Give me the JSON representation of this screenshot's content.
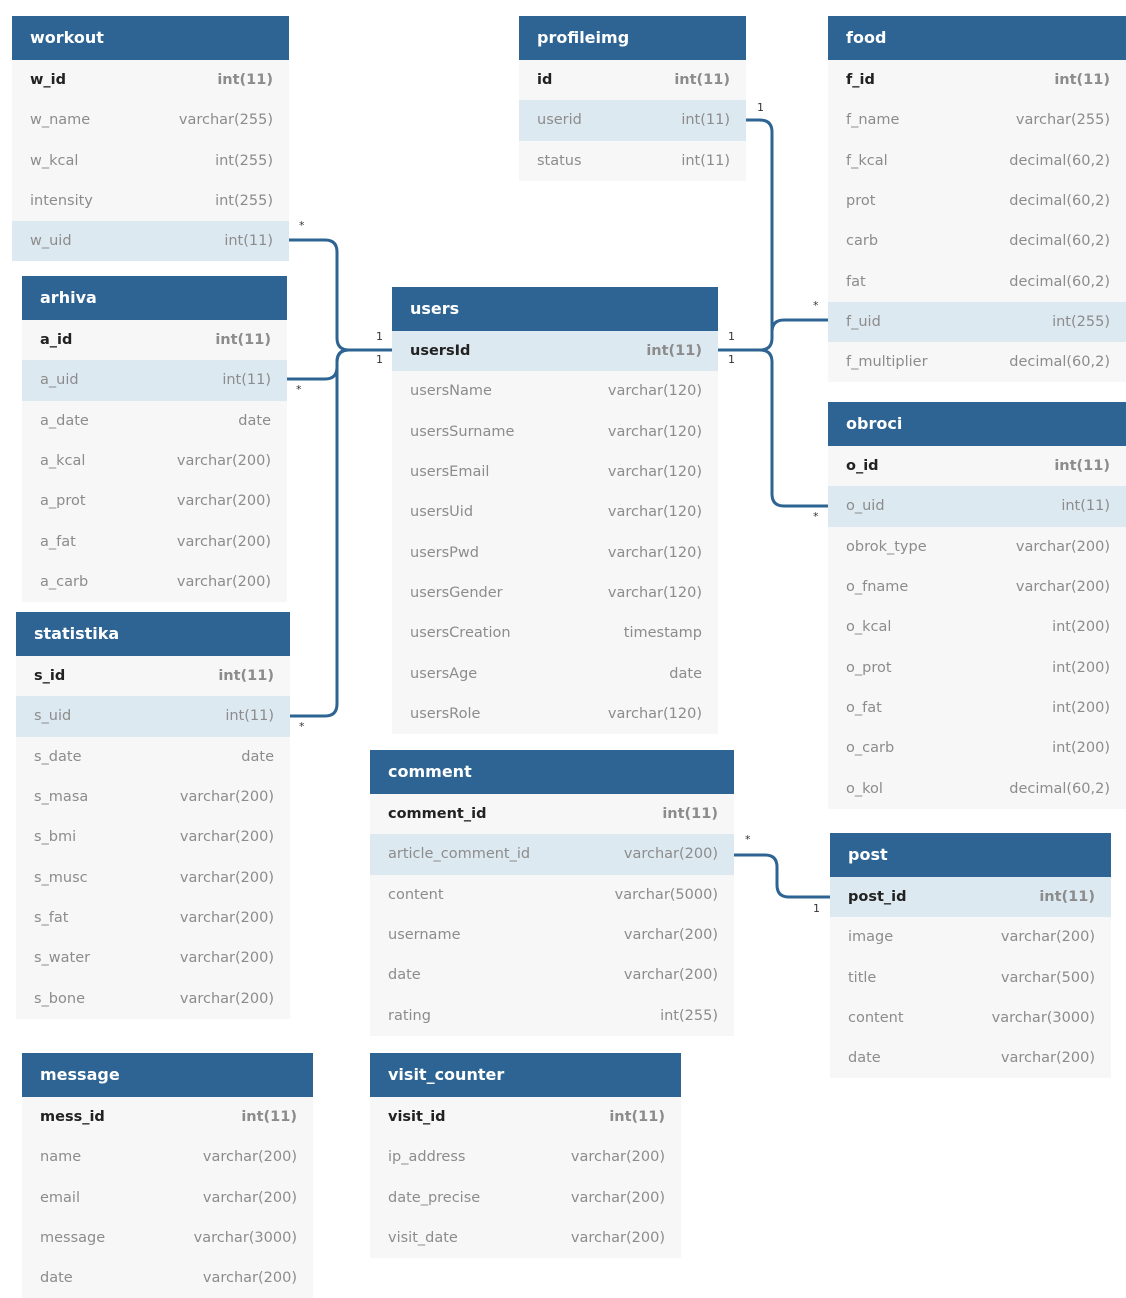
{
  "colors": {
    "header": "#2d6493",
    "connector": "#2d6493",
    "highlight": "#dde9f1",
    "body": "#f7f7f7"
  },
  "tables": [
    {
      "id": "workout",
      "name": "workout",
      "fields": [
        {
          "name": "w_id",
          "type": "int(11)",
          "pk": true
        },
        {
          "name": "w_name",
          "type": "varchar(255)"
        },
        {
          "name": "w_kcal",
          "type": "int(255)"
        },
        {
          "name": "intensity",
          "type": "int(255)"
        },
        {
          "name": "w_uid",
          "type": "int(11)",
          "hl": true
        }
      ]
    },
    {
      "id": "arhiva",
      "name": "arhiva",
      "fields": [
        {
          "name": "a_id",
          "type": "int(11)",
          "pk": true
        },
        {
          "name": "a_uid",
          "type": "int(11)",
          "hl": true
        },
        {
          "name": "a_date",
          "type": "date"
        },
        {
          "name": "a_kcal",
          "type": "varchar(200)"
        },
        {
          "name": "a_prot",
          "type": "varchar(200)"
        },
        {
          "name": "a_fat",
          "type": "varchar(200)"
        },
        {
          "name": "a_carb",
          "type": "varchar(200)"
        }
      ]
    },
    {
      "id": "statistika",
      "name": "statistika",
      "fields": [
        {
          "name": "s_id",
          "type": "int(11)",
          "pk": true
        },
        {
          "name": "s_uid",
          "type": "int(11)",
          "hl": true
        },
        {
          "name": "s_date",
          "type": "date"
        },
        {
          "name": "s_masa",
          "type": "varchar(200)"
        },
        {
          "name": "s_bmi",
          "type": "varchar(200)"
        },
        {
          "name": "s_musc",
          "type": "varchar(200)"
        },
        {
          "name": "s_fat",
          "type": "varchar(200)"
        },
        {
          "name": "s_water",
          "type": "varchar(200)"
        },
        {
          "name": "s_bone",
          "type": "varchar(200)"
        }
      ]
    },
    {
      "id": "message",
      "name": "message",
      "fields": [
        {
          "name": "mess_id",
          "type": "int(11)",
          "pk": true
        },
        {
          "name": "name",
          "type": "varchar(200)"
        },
        {
          "name": "email",
          "type": "varchar(200)"
        },
        {
          "name": "message",
          "type": "varchar(3000)"
        },
        {
          "name": "date",
          "type": "varchar(200)"
        }
      ]
    },
    {
      "id": "profileimg",
      "name": "profileimg",
      "fields": [
        {
          "name": "id",
          "type": "int(11)",
          "pk": true
        },
        {
          "name": "userid",
          "type": "int(11)",
          "hl": true
        },
        {
          "name": "status",
          "type": "int(11)"
        }
      ]
    },
    {
      "id": "users",
      "name": "users",
      "fields": [
        {
          "name": "usersId",
          "type": "int(11)",
          "pk": true,
          "hl": true
        },
        {
          "name": "usersName",
          "type": "varchar(120)"
        },
        {
          "name": "usersSurname",
          "type": "varchar(120)"
        },
        {
          "name": "usersEmail",
          "type": "varchar(120)"
        },
        {
          "name": "usersUid",
          "type": "varchar(120)"
        },
        {
          "name": "usersPwd",
          "type": "varchar(120)"
        },
        {
          "name": "usersGender",
          "type": "varchar(120)"
        },
        {
          "name": "usersCreation",
          "type": "timestamp"
        },
        {
          "name": "usersAge",
          "type": "date"
        },
        {
          "name": "usersRole",
          "type": "varchar(120)"
        }
      ]
    },
    {
      "id": "comment",
      "name": "comment",
      "fields": [
        {
          "name": "comment_id",
          "type": "int(11)",
          "pk": true
        },
        {
          "name": "article_comment_id",
          "type": "varchar(200)",
          "hl": true
        },
        {
          "name": "content",
          "type": "varchar(5000)"
        },
        {
          "name": "username",
          "type": "varchar(200)"
        },
        {
          "name": "date",
          "type": "varchar(200)"
        },
        {
          "name": "rating",
          "type": "int(255)"
        }
      ]
    },
    {
      "id": "visit_counter",
      "name": "visit_counter",
      "fields": [
        {
          "name": "visit_id",
          "type": "int(11)",
          "pk": true
        },
        {
          "name": "ip_address",
          "type": "varchar(200)"
        },
        {
          "name": "date_precise",
          "type": "varchar(200)"
        },
        {
          "name": "visit_date",
          "type": "varchar(200)"
        }
      ]
    },
    {
      "id": "food",
      "name": "food",
      "fields": [
        {
          "name": "f_id",
          "type": "int(11)",
          "pk": true
        },
        {
          "name": "f_name",
          "type": "varchar(255)"
        },
        {
          "name": "f_kcal",
          "type": "decimal(60,2)"
        },
        {
          "name": "prot",
          "type": "decimal(60,2)"
        },
        {
          "name": "carb",
          "type": "decimal(60,2)"
        },
        {
          "name": "fat",
          "type": "decimal(60,2)"
        },
        {
          "name": "f_uid",
          "type": "int(255)",
          "hl": true
        },
        {
          "name": "f_multiplier",
          "type": "decimal(60,2)"
        }
      ]
    },
    {
      "id": "obroci",
      "name": "obroci",
      "fields": [
        {
          "name": "o_id",
          "type": "int(11)",
          "pk": true
        },
        {
          "name": "o_uid",
          "type": "int(11)",
          "hl": true
        },
        {
          "name": "obrok_type",
          "type": "varchar(200)"
        },
        {
          "name": "o_fname",
          "type": "varchar(200)"
        },
        {
          "name": "o_kcal",
          "type": "int(200)"
        },
        {
          "name": "o_prot",
          "type": "int(200)"
        },
        {
          "name": "o_fat",
          "type": "int(200)"
        },
        {
          "name": "o_carb",
          "type": "int(200)"
        },
        {
          "name": "o_kol",
          "type": "decimal(60,2)"
        }
      ]
    },
    {
      "id": "post",
      "name": "post",
      "fields": [
        {
          "name": "post_id",
          "type": "int(11)",
          "pk": true,
          "hl": true
        },
        {
          "name": "image",
          "type": "varchar(200)"
        },
        {
          "name": "title",
          "type": "varchar(500)"
        },
        {
          "name": "content",
          "type": "varchar(3000)"
        },
        {
          "name": "date",
          "type": "varchar(200)"
        }
      ]
    }
  ],
  "relations": [
    {
      "from": "workout.w_uid",
      "to": "users.usersId",
      "from_card": "*",
      "to_card": "1"
    },
    {
      "from": "arhiva.a_uid",
      "to": "users.usersId",
      "from_card": "*",
      "to_card": "1"
    },
    {
      "from": "statistika.s_uid",
      "to": "users.usersId",
      "from_card": "*",
      "to_card": "1"
    },
    {
      "from": "profileimg.userid",
      "to": "users.usersId",
      "from_card": "1",
      "to_card": "1"
    },
    {
      "from": "food.f_uid",
      "to": "users.usersId",
      "from_card": "*",
      "to_card": "1"
    },
    {
      "from": "obroci.o_uid",
      "to": "users.usersId",
      "from_card": "*",
      "to_card": "1"
    },
    {
      "from": "comment.article_comment_id",
      "to": "post.post_id",
      "from_card": "*",
      "to_card": "1"
    }
  ]
}
